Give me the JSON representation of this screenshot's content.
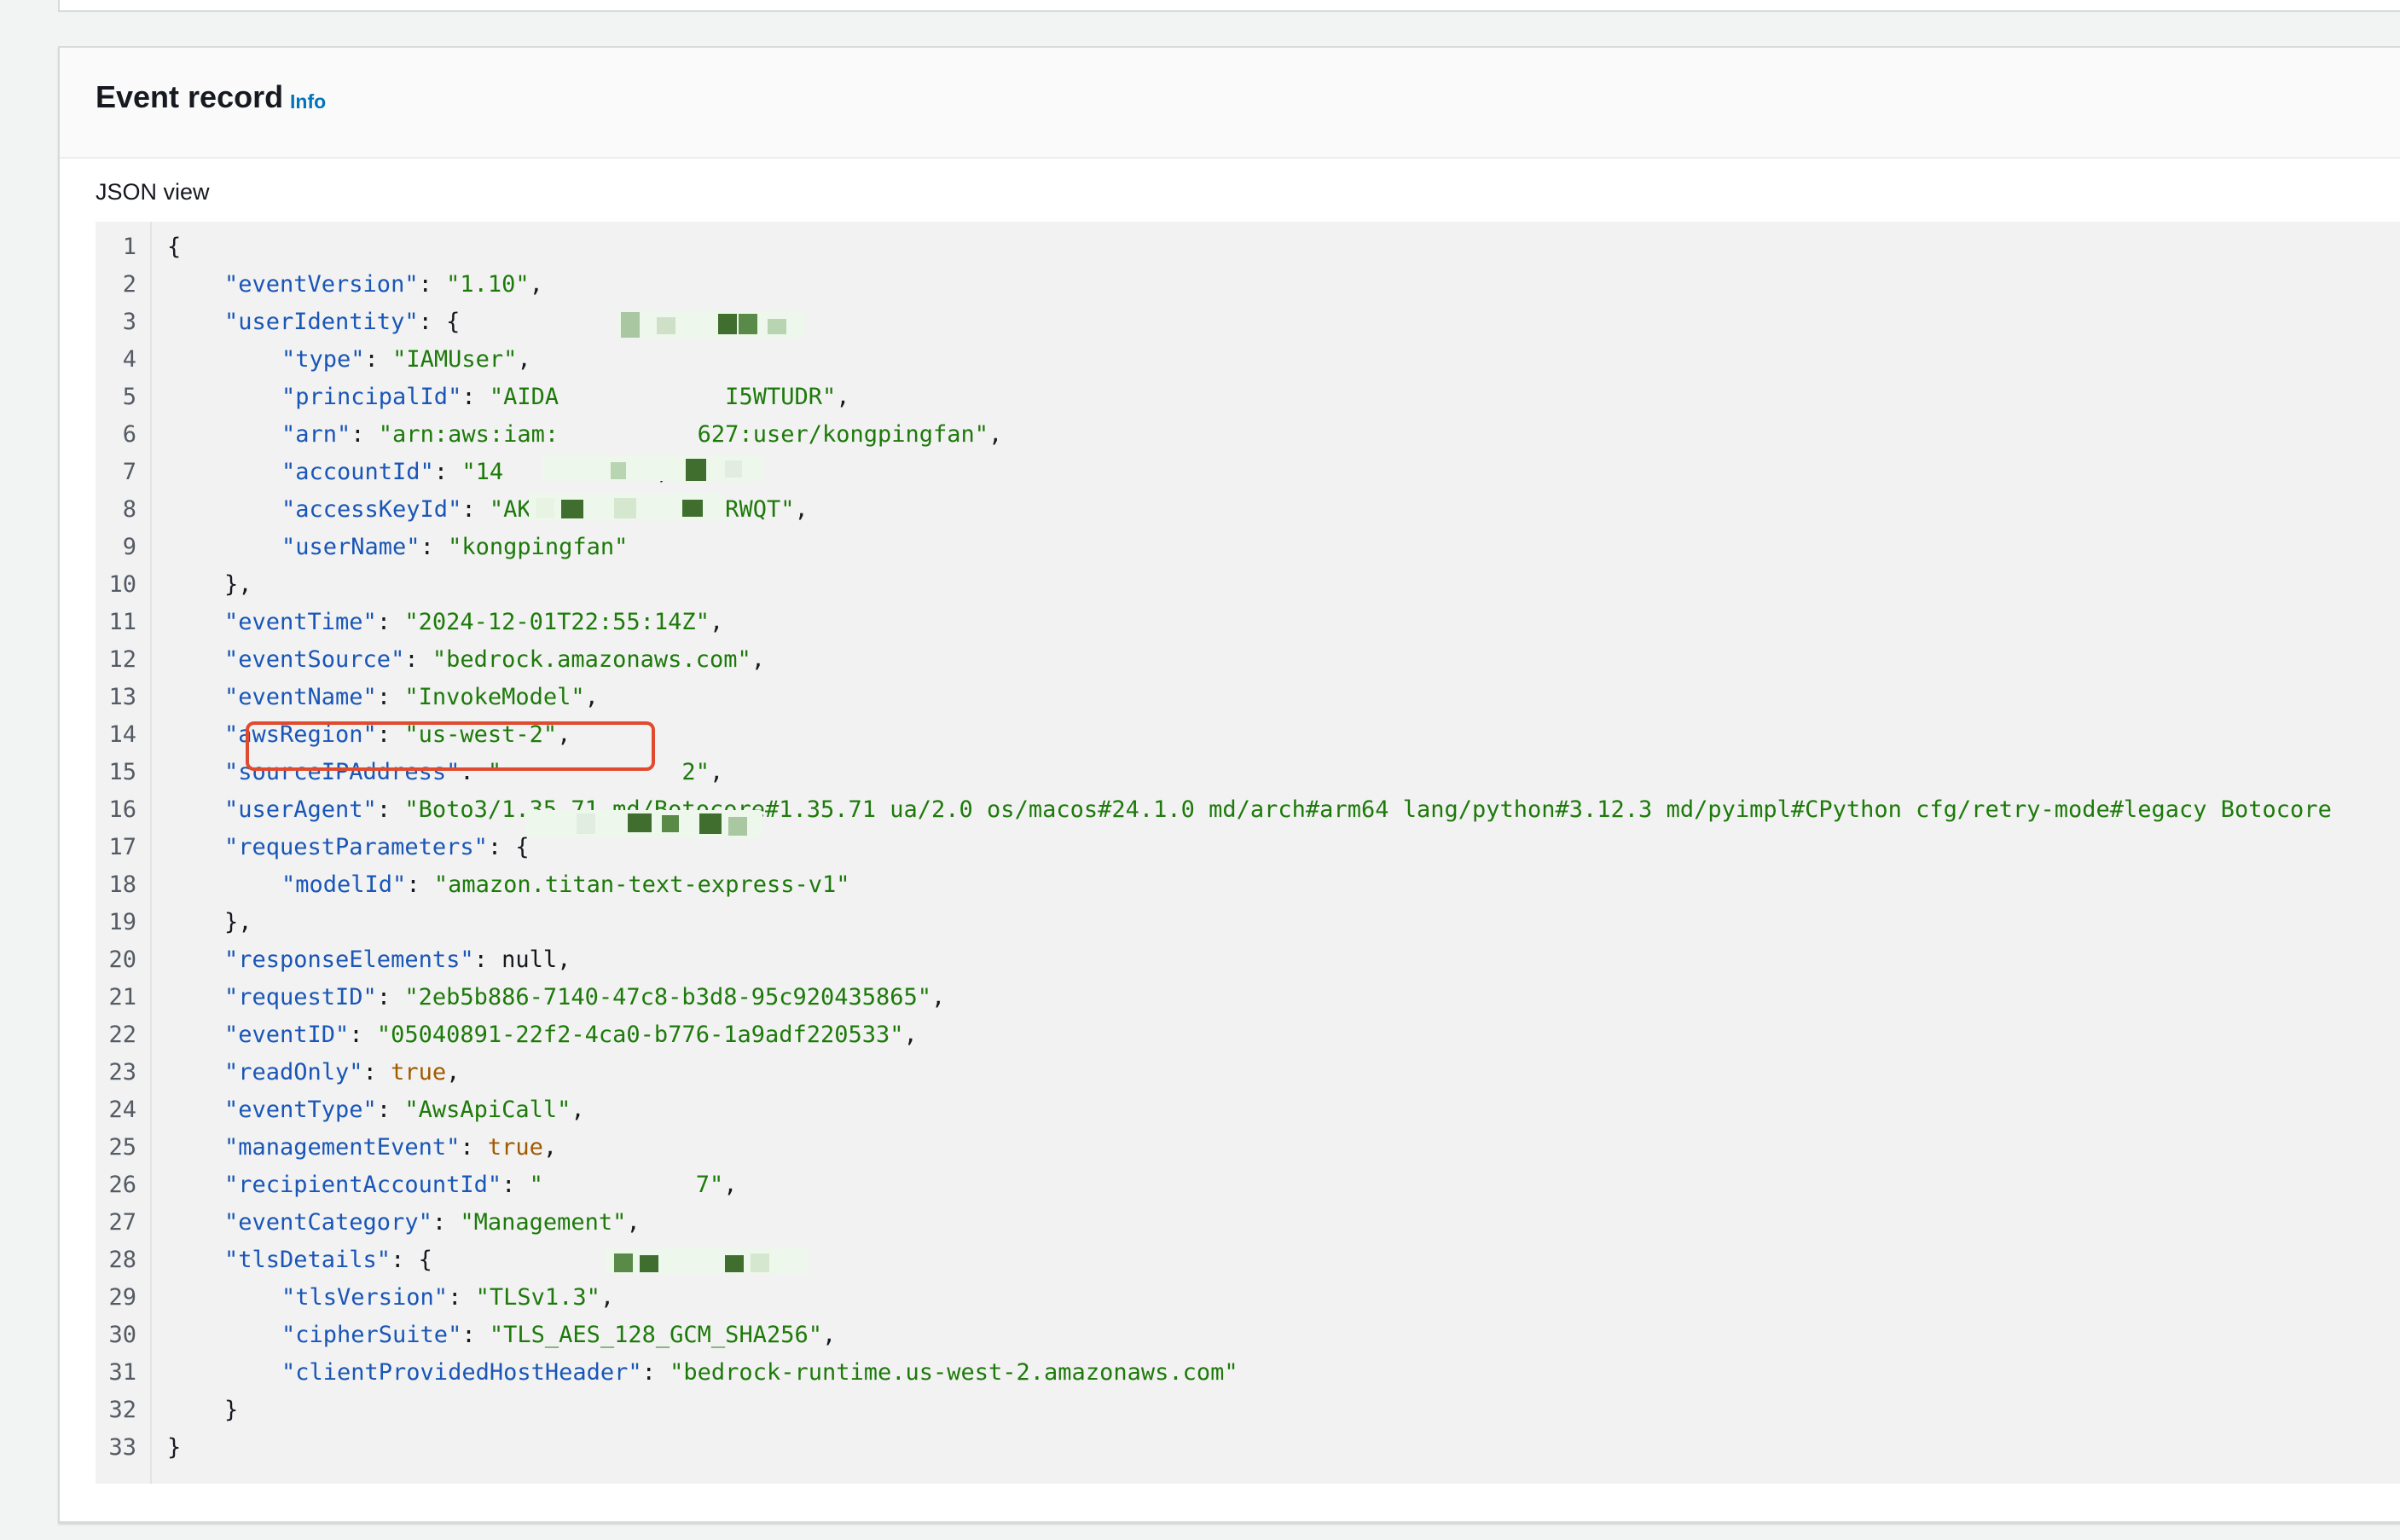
{
  "card": {
    "title": "Event record",
    "info_link": "Info",
    "view_label": "JSON view"
  },
  "json_lines": [
    {
      "n": "1",
      "indent": 0,
      "parts": [
        {
          "t": "{",
          "c": "p"
        }
      ]
    },
    {
      "n": "2",
      "indent": 1,
      "parts": [
        {
          "t": "\"eventVersion\"",
          "c": "k"
        },
        {
          "t": ": ",
          "c": "p"
        },
        {
          "t": "\"1.10\"",
          "c": "s"
        },
        {
          "t": ",",
          "c": "p"
        }
      ]
    },
    {
      "n": "3",
      "indent": 1,
      "parts": [
        {
          "t": "\"userIdentity\"",
          "c": "k"
        },
        {
          "t": ": {",
          "c": "p"
        }
      ]
    },
    {
      "n": "4",
      "indent": 2,
      "parts": [
        {
          "t": "\"type\"",
          "c": "k"
        },
        {
          "t": ": ",
          "c": "p"
        },
        {
          "t": "\"IAMUser\"",
          "c": "s"
        },
        {
          "t": ",",
          "c": "p"
        }
      ]
    },
    {
      "n": "5",
      "indent": 2,
      "parts": [
        {
          "t": "\"principalId\"",
          "c": "k"
        },
        {
          "t": ": ",
          "c": "p"
        },
        {
          "t": "\"AIDA            I5WTUDR\"",
          "c": "s"
        },
        {
          "t": ",",
          "c": "p"
        }
      ]
    },
    {
      "n": "6",
      "indent": 2,
      "parts": [
        {
          "t": "\"arn\"",
          "c": "k"
        },
        {
          "t": ": ",
          "c": "p"
        },
        {
          "t": "\"arn:aws:iam:          627:user/kongpingfan\"",
          "c": "s"
        },
        {
          "t": ",",
          "c": "p"
        }
      ]
    },
    {
      "n": "7",
      "indent": 2,
      "parts": [
        {
          "t": "\"accountId\"",
          "c": "k"
        },
        {
          "t": ": ",
          "c": "p"
        },
        {
          "t": "\"14          \"",
          "c": "s"
        },
        {
          "t": ",",
          "c": "p"
        }
      ]
    },
    {
      "n": "8",
      "indent": 2,
      "parts": [
        {
          "t": "\"accessKeyId\"",
          "c": "k"
        },
        {
          "t": ": ",
          "c": "p"
        },
        {
          "t": "\"AKIASDTTSNZR3E2SRWQT\"",
          "c": "s"
        },
        {
          "t": ",",
          "c": "p"
        }
      ]
    },
    {
      "n": "9",
      "indent": 2,
      "parts": [
        {
          "t": "\"userName\"",
          "c": "k"
        },
        {
          "t": ": ",
          "c": "p"
        },
        {
          "t": "\"kongpingfan\"",
          "c": "s"
        }
      ]
    },
    {
      "n": "10",
      "indent": 1,
      "parts": [
        {
          "t": "},",
          "c": "p"
        }
      ]
    },
    {
      "n": "11",
      "indent": 1,
      "parts": [
        {
          "t": "\"eventTime\"",
          "c": "k"
        },
        {
          "t": ": ",
          "c": "p"
        },
        {
          "t": "\"2024-12-01T22:55:14Z\"",
          "c": "s"
        },
        {
          "t": ",",
          "c": "p"
        }
      ]
    },
    {
      "n": "12",
      "indent": 1,
      "parts": [
        {
          "t": "\"eventSource\"",
          "c": "k"
        },
        {
          "t": ": ",
          "c": "p"
        },
        {
          "t": "\"bedrock.amazonaws.com\"",
          "c": "s"
        },
        {
          "t": ",",
          "c": "p"
        }
      ]
    },
    {
      "n": "13",
      "indent": 1,
      "parts": [
        {
          "t": "\"eventName\"",
          "c": "k"
        },
        {
          "t": ": ",
          "c": "p"
        },
        {
          "t": "\"InvokeModel\"",
          "c": "s"
        },
        {
          "t": ",",
          "c": "p"
        }
      ]
    },
    {
      "n": "14",
      "indent": 1,
      "parts": [
        {
          "t": "\"awsRegion\"",
          "c": "k"
        },
        {
          "t": ": ",
          "c": "p"
        },
        {
          "t": "\"us-west-2\"",
          "c": "s"
        },
        {
          "t": ",",
          "c": "p"
        }
      ]
    },
    {
      "n": "15",
      "indent": 1,
      "parts": [
        {
          "t": "\"sourceIPAddress\"",
          "c": "k"
        },
        {
          "t": ": ",
          "c": "p"
        },
        {
          "t": "\"             2\"",
          "c": "s"
        },
        {
          "t": ",",
          "c": "p"
        }
      ]
    },
    {
      "n": "16",
      "indent": 1,
      "parts": [
        {
          "t": "\"userAgent\"",
          "c": "k"
        },
        {
          "t": ": ",
          "c": "p"
        },
        {
          "t": "\"Boto3/1.35.71 md/Botocore#1.35.71 ua/2.0 os/macos#24.1.0 md/arch#arm64 lang/python#3.12.3 md/pyimpl#CPython cfg/retry-mode#legacy Botocore",
          "c": "s"
        }
      ]
    },
    {
      "n": "17",
      "indent": 1,
      "parts": [
        {
          "t": "\"requestParameters\"",
          "c": "k"
        },
        {
          "t": ": {",
          "c": "p"
        }
      ]
    },
    {
      "n": "18",
      "indent": 2,
      "parts": [
        {
          "t": "\"modelId\"",
          "c": "k"
        },
        {
          "t": ": ",
          "c": "p"
        },
        {
          "t": "\"amazon.titan-text-express-v1\"",
          "c": "s"
        }
      ]
    },
    {
      "n": "19",
      "indent": 1,
      "parts": [
        {
          "t": "},",
          "c": "p"
        }
      ]
    },
    {
      "n": "20",
      "indent": 1,
      "parts": [
        {
          "t": "\"responseElements\"",
          "c": "k"
        },
        {
          "t": ": null,",
          "c": "p"
        }
      ]
    },
    {
      "n": "21",
      "indent": 1,
      "parts": [
        {
          "t": "\"requestID\"",
          "c": "k"
        },
        {
          "t": ": ",
          "c": "p"
        },
        {
          "t": "\"2eb5b886-7140-47c8-b3d8-95c920435865\"",
          "c": "s"
        },
        {
          "t": ",",
          "c": "p"
        }
      ]
    },
    {
      "n": "22",
      "indent": 1,
      "parts": [
        {
          "t": "\"eventID\"",
          "c": "k"
        },
        {
          "t": ": ",
          "c": "p"
        },
        {
          "t": "\"05040891-22f2-4ca0-b776-1a9adf220533\"",
          "c": "s"
        },
        {
          "t": ",",
          "c": "p"
        }
      ]
    },
    {
      "n": "23",
      "indent": 1,
      "parts": [
        {
          "t": "\"readOnly\"",
          "c": "k"
        },
        {
          "t": ": ",
          "c": "p"
        },
        {
          "t": "true",
          "c": "b"
        },
        {
          "t": ",",
          "c": "p"
        }
      ]
    },
    {
      "n": "24",
      "indent": 1,
      "parts": [
        {
          "t": "\"eventType\"",
          "c": "k"
        },
        {
          "t": ": ",
          "c": "p"
        },
        {
          "t": "\"AwsApiCall\"",
          "c": "s"
        },
        {
          "t": ",",
          "c": "p"
        }
      ]
    },
    {
      "n": "25",
      "indent": 1,
      "parts": [
        {
          "t": "\"managementEvent\"",
          "c": "k"
        },
        {
          "t": ": ",
          "c": "p"
        },
        {
          "t": "true",
          "c": "b"
        },
        {
          "t": ",",
          "c": "p"
        }
      ]
    },
    {
      "n": "26",
      "indent": 1,
      "parts": [
        {
          "t": "\"recipientAccountId\"",
          "c": "k"
        },
        {
          "t": ": ",
          "c": "p"
        },
        {
          "t": "\"           7\"",
          "c": "s"
        },
        {
          "t": ",",
          "c": "p"
        }
      ]
    },
    {
      "n": "27",
      "indent": 1,
      "parts": [
        {
          "t": "\"eventCategory\"",
          "c": "k"
        },
        {
          "t": ": ",
          "c": "p"
        },
        {
          "t": "\"Management\"",
          "c": "s"
        },
        {
          "t": ",",
          "c": "p"
        }
      ]
    },
    {
      "n": "28",
      "indent": 1,
      "parts": [
        {
          "t": "\"tlsDetails\"",
          "c": "k"
        },
        {
          "t": ": {",
          "c": "p"
        }
      ]
    },
    {
      "n": "29",
      "indent": 2,
      "parts": [
        {
          "t": "\"tlsVersion\"",
          "c": "k"
        },
        {
          "t": ": ",
          "c": "p"
        },
        {
          "t": "\"TLSv1.3\"",
          "c": "s"
        },
        {
          "t": ",",
          "c": "p"
        }
      ]
    },
    {
      "n": "30",
      "indent": 2,
      "parts": [
        {
          "t": "\"cipherSuite\"",
          "c": "k"
        },
        {
          "t": ": ",
          "c": "p"
        },
        {
          "t": "\"TLS_AES_128_GCM_SHA256\"",
          "c": "s"
        },
        {
          "t": ",",
          "c": "p"
        }
      ]
    },
    {
      "n": "31",
      "indent": 2,
      "parts": [
        {
          "t": "\"clientProvidedHostHeader\"",
          "c": "k"
        },
        {
          "t": ": ",
          "c": "p"
        },
        {
          "t": "\"bedrock-runtime.us-west-2.amazonaws.com\"",
          "c": "s"
        }
      ]
    },
    {
      "n": "32",
      "indent": 1,
      "parts": [
        {
          "t": "}",
          "c": "p"
        }
      ]
    },
    {
      "n": "33",
      "indent": 0,
      "parts": [
        {
          "t": "}",
          "c": "p"
        }
      ]
    }
  ],
  "colors": {
    "json_key": "#1956b7",
    "json_string": "#1d7a0a",
    "json_boolean": "#a05a00",
    "highlight_border": "#e04a2f",
    "info_link": "#0073bb"
  }
}
